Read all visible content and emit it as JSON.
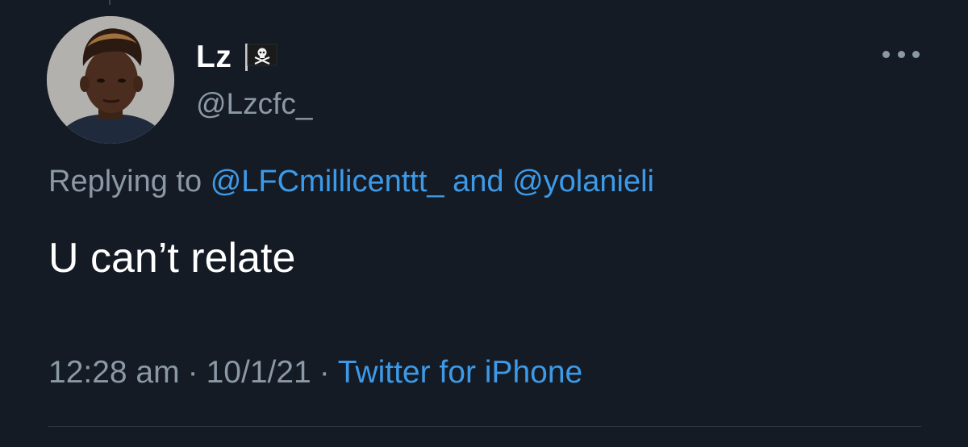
{
  "tweet": {
    "display_name": "Lz",
    "handle": "@Lzcfc_",
    "flag_emoji": "pirate-flag-icon",
    "replying_prefix": "Replying to",
    "reply_mention_1": "@LFCmillicenttt_",
    "reply_and": "and",
    "reply_mention_2": "@yolanieli",
    "text": "U can’t relate",
    "time": "12:28 am",
    "date": "10/1/21",
    "source": "Twitter for iPhone",
    "separator": "·"
  },
  "colors": {
    "background": "#151b24",
    "secondary_text": "#8b98a5",
    "link": "#3d9ae8",
    "primary_text": "#ffffff"
  }
}
